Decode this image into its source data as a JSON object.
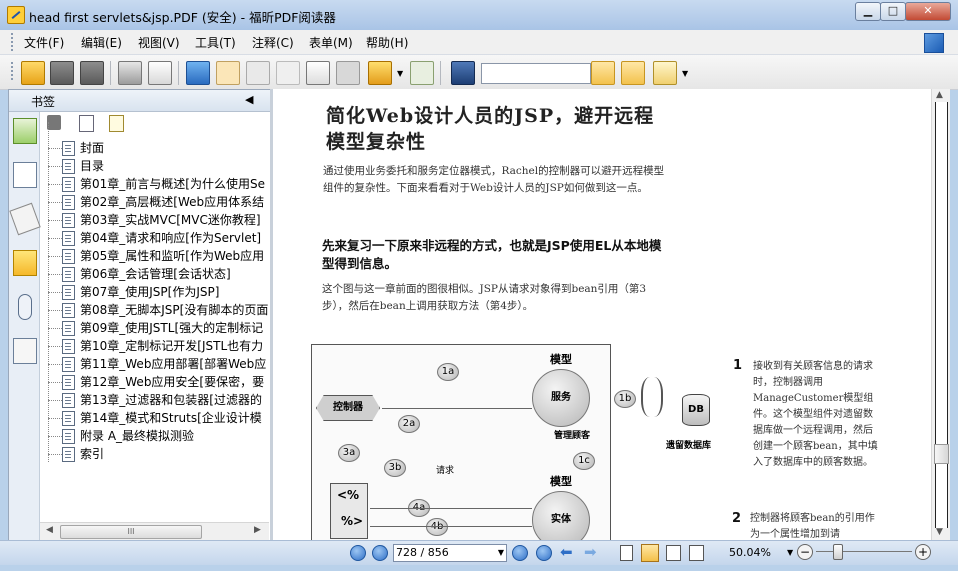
{
  "window": {
    "title": "head first servlets&jsp.PDF (安全) - 福昕PDF阅读器",
    "min_label": "▁",
    "max_label": "□",
    "close_label": "✕"
  },
  "menu": {
    "items": [
      "文件(F)",
      "编辑(E)",
      "视图(V)",
      "工具(T)",
      "注释(C)",
      "表单(M)",
      "帮助(H)"
    ]
  },
  "toolbar": {
    "search_value": "",
    "icons": [
      "open-folder-icon",
      "save-icon",
      "save-as-icon",
      "print-icon",
      "email-icon",
      "full-screen-icon",
      "hand-tool-icon",
      "zoom-tool-icon",
      "select-tool-icon",
      "text-select-icon",
      "snapshot-icon",
      "rms-icon",
      "sign-icon",
      "find-icon",
      "prev-result-icon",
      "next-result-icon",
      "highlight-icon"
    ]
  },
  "sidebar": {
    "header_label": "书签",
    "collapse_glyph": "◀",
    "bookmarks": [
      "封面",
      "目录",
      "第01章_前言与概述[为什么使用Se",
      "第02章_高层概述[Web应用体系结",
      "第03章_实战MVC[MVC迷你教程]",
      "第04章_请求和响应[作为Servlet]",
      "第05章_属性和监听[作为Web应用",
      "第06章_会话管理[会话状态]",
      "第07章_使用JSP[作为JSP]",
      "第08章_无脚本JSP[没有脚本的页面",
      "第09章_使用JSTL[强大的定制标记",
      "第10章_定制标记开发[JSTL也有力",
      "第11章_Web应用部署[部署Web应",
      "第12章_Web应用安全[要保密，要",
      "第13章_过滤器和包装器[过滤器的",
      "第14章_模式和Struts[企业设计模",
      "附录 A_最终模拟测验",
      "索引"
    ],
    "scroll_mid": "III"
  },
  "page": {
    "title_line1": "简化Web设计人员的JSP，避开远程",
    "title_line2": "模型复杂性",
    "intro": "通过使用业务委托和服务定位器模式，Rachel的控制器可以避开远程模型组件的复杂性。下面来看看对于Web设计人员的JSP如何做到这一点。",
    "heading": "先来复习一下原来非远程的方式，也就是JSP使用EL从本地模型得到信息。",
    "para": "这个图与这一章前面的图很相似。JSP从请求对象得到bean引用（第3步），然后在bean上调用获取方法（第4步）。",
    "diagram": {
      "model_label": "模型",
      "service_label": "服务",
      "manage_label": "管理顾客",
      "controller_label": "控制器",
      "db_label": "DB",
      "db_caption": "遗留数据库",
      "request_label": "请求",
      "entity_label": "实体",
      "model2_label": "模型",
      "jsp_label1": "<%",
      "jsp_label2": "%>",
      "steps": [
        "1a",
        "1b",
        "1c",
        "2a",
        "3a",
        "3b",
        "4a",
        "4b"
      ]
    },
    "note1_num": "1",
    "note1": "接收到有关顾客信息的请求时，控制器调用ManageCustomer模型组件。这个模型组件对遗留数据库做一个远程调用，然后创建一个顾客bean，其中填入了数据库中的顾客数据。",
    "note2_num": "2",
    "note2": "控制器将顾客bean的引用作为一个属性增加到请"
  },
  "status": {
    "page_display": "728 / 856",
    "zoom": "50.04%",
    "zoom_minus": "−",
    "zoom_plus": "+"
  }
}
